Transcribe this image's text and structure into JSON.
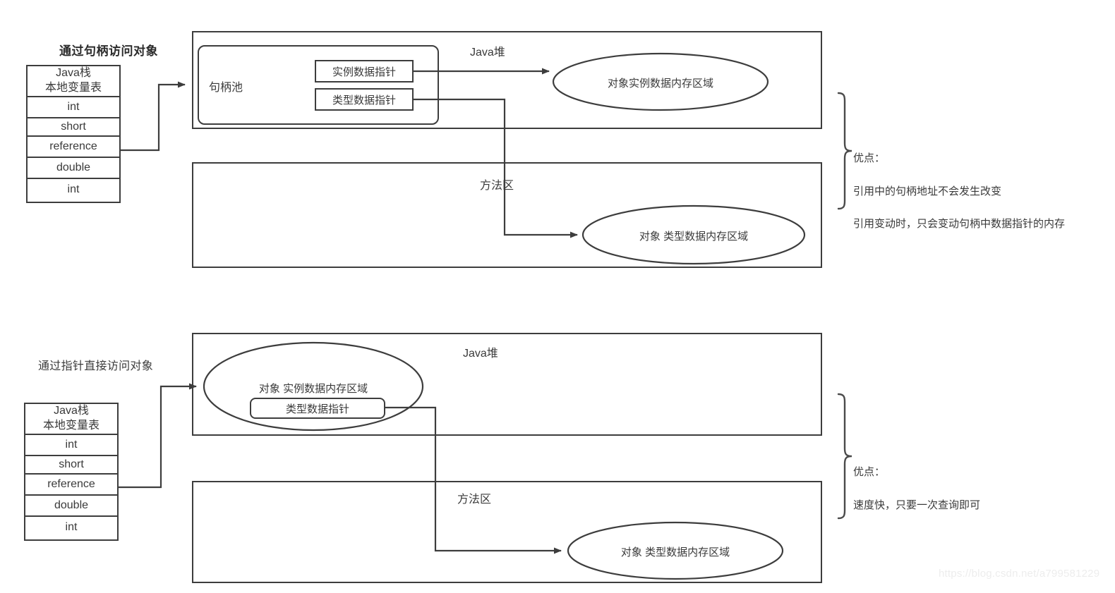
{
  "diagram": {
    "title_top": "通过句柄访问对象",
    "title_bottom": "通过指针直接访问对象"
  },
  "stack_top": {
    "header_line1": "Java栈",
    "header_line2": "本地变量表",
    "rows": [
      "int",
      "short",
      "reference",
      "double",
      "int"
    ]
  },
  "stack_bottom": {
    "header_line1": "Java栈",
    "header_line2": "本地变量表",
    "rows": [
      "int",
      "short",
      "reference",
      "double",
      "int"
    ]
  },
  "top_section": {
    "heap_label": "Java堆",
    "method_area_label": "方法区",
    "handle_pool_label": "句柄池",
    "instance_pointer": "实例数据指针",
    "type_pointer": "类型数据指针",
    "instance_ellipse": "对象实例数据内存区域",
    "type_ellipse": "对象 类型数据内存区域",
    "note_title": "优点：",
    "note_line1": "引用中的句柄地址不会发生改变",
    "note_line2": "引用变动时，只会变动句柄中数据指针的内存"
  },
  "bottom_section": {
    "heap_label": "Java堆",
    "method_area_label": "方法区",
    "instance_ellipse": "对象 实例数据内存区域",
    "type_pointer": "类型数据指针",
    "type_ellipse": "对象 类型数据内存区域",
    "note_title": "优点：",
    "note_line1": "速度快，只要一次查询即可"
  },
  "watermark": "https://blog.csdn.net/a799581229",
  "colors": {
    "stroke": "#3d3d3d",
    "text": "#3a3a3a",
    "background": "#ffffff",
    "watermark": "#ededed"
  }
}
